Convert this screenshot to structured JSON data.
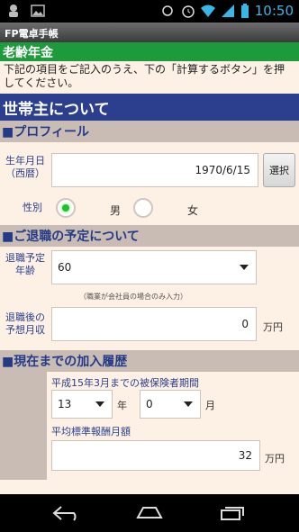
{
  "status": {
    "time": "10:50"
  },
  "titlebar": {
    "title": "FP電卓手帳"
  },
  "section_title": "老齢年金",
  "intro_text": "下記の項目をご記入のうえ、下の「計算するボタン」を押してください。",
  "main_header": "世帯主について",
  "profile": {
    "header": "■プロフィール",
    "birth_label_line1": "生年月日",
    "birth_label_line2": "（西暦）",
    "birth_value": "1970/6/15",
    "select_button": "選択",
    "gender_label": "性別",
    "male": "男",
    "female": "女",
    "selected_gender": "male"
  },
  "retirement": {
    "header": "■ご退職の予定について",
    "age_label_line1": "退職予定",
    "age_label_line2": "年齢",
    "age_value": "60",
    "note": "（職業が会社員の場合のみ入力）",
    "income_label_line1": "退職後の",
    "income_label_line2": "予想月収",
    "income_value": "0",
    "income_unit": "万円"
  },
  "history": {
    "header": "■現在までの加入履歴",
    "period_label": "平成15年3月までの被保険者期間",
    "years_value": "13",
    "years_unit": "年",
    "months_value": "0",
    "months_unit": "月",
    "avg_label": "平均標準報酬月額",
    "avg_value": "32",
    "avg_unit": "万円"
  }
}
